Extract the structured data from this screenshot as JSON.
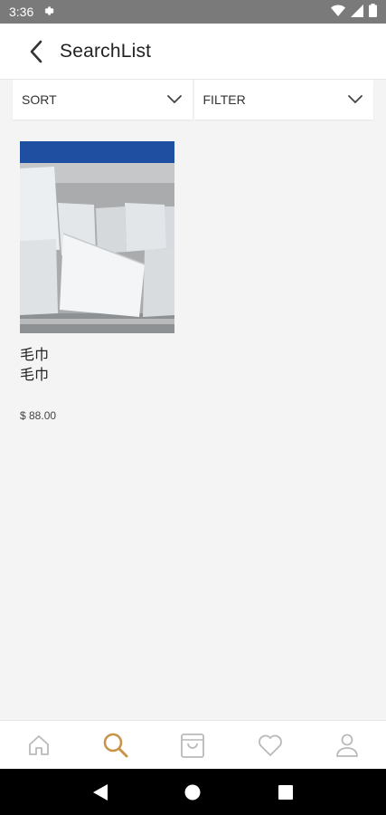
{
  "status_bar": {
    "time": "3:36",
    "icons": [
      "gear-icon",
      "wifi-icon",
      "signal-icon",
      "battery-icon"
    ]
  },
  "app_bar": {
    "title": "SearchList",
    "back_icon": "back-arrow-icon"
  },
  "toolbar": {
    "sort_label": "SORT",
    "filter_label": "FILTER"
  },
  "products": [
    {
      "name_line1": "毛巾",
      "name_line2": "毛巾",
      "price": "$ 88.00"
    }
  ],
  "bottom_nav": {
    "items": [
      "home-icon",
      "search-icon",
      "bag-icon",
      "heart-icon",
      "profile-icon"
    ],
    "active": "search-icon",
    "active_color": "#c8944a",
    "inactive_color": "#b9b9b9"
  },
  "colors": {
    "status_bar": "#7a7a7a",
    "background": "#f4f4f4",
    "accent": "#c8944a"
  }
}
